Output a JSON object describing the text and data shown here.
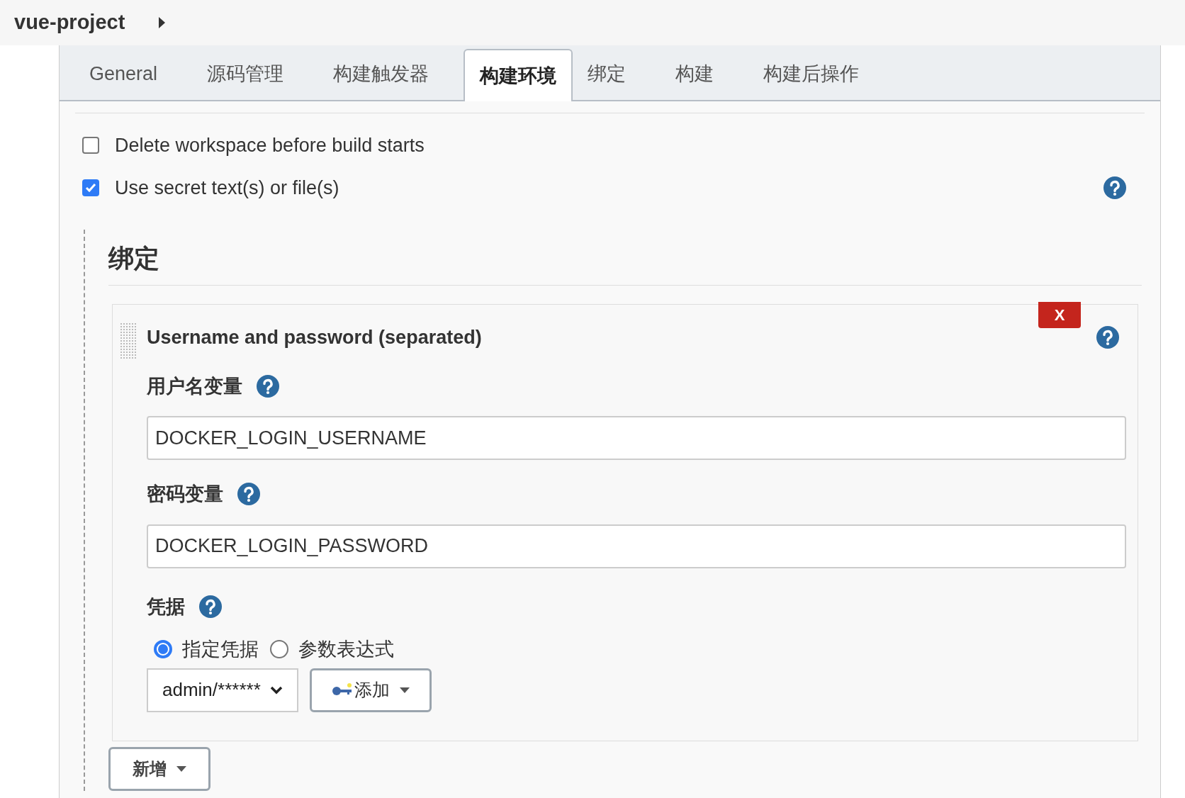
{
  "header": {
    "title": "vue-project"
  },
  "tabs": [
    {
      "label": "General",
      "selected": false
    },
    {
      "label": "源码管理",
      "selected": false
    },
    {
      "label": "构建触发器",
      "selected": false
    },
    {
      "label": "构建环境",
      "selected": true
    },
    {
      "label": "绑定",
      "selected": false
    },
    {
      "label": "构建",
      "selected": false
    },
    {
      "label": "构建后操作",
      "selected": false
    }
  ],
  "options": [
    {
      "label": "Delete workspace before build starts",
      "checked": false,
      "help": false
    },
    {
      "label": "Use secret text(s) or file(s)",
      "checked": true,
      "help": true
    }
  ],
  "bindings": {
    "heading": "绑定",
    "card": {
      "title": "Username and password (separated)",
      "delete_label": "X",
      "fields": [
        {
          "label": "用户名变量",
          "value": "DOCKER_LOGIN_USERNAME"
        },
        {
          "label": "密码变量",
          "value": "DOCKER_LOGIN_PASSWORD"
        }
      ],
      "credentials": {
        "label": "凭据",
        "radios": [
          {
            "label": "指定凭据",
            "selected": true
          },
          {
            "label": "参数表达式",
            "selected": false
          }
        ],
        "select_value": "admin/******",
        "add_label": "添加"
      }
    },
    "add_button": "新增"
  }
}
